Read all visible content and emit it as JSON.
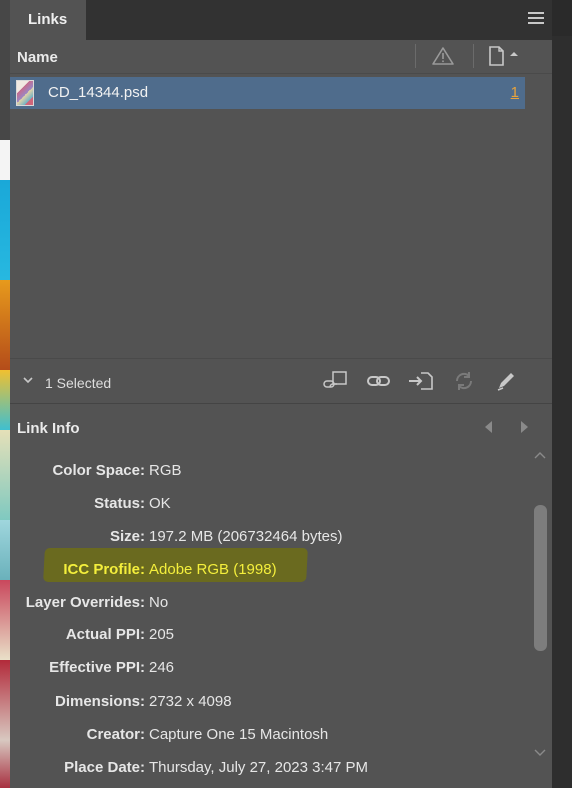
{
  "panel": {
    "tab_label": "Links"
  },
  "list": {
    "column_name": "Name",
    "items": [
      {
        "name": "CD_14344.psd",
        "page": "1"
      }
    ]
  },
  "toolbar": {
    "selection_text": "1 Selected",
    "icons": [
      "relink-from-cc-icon",
      "relink-icon",
      "go-to-link-icon",
      "update-link-icon",
      "edit-original-icon"
    ]
  },
  "link_info": {
    "title": "Link Info",
    "rows": [
      {
        "label": "Color Space:",
        "value": "RGB"
      },
      {
        "label": "Status:",
        "value": "OK"
      },
      {
        "label": "Size:",
        "value": "197.2 MB (206732464 bytes)"
      },
      {
        "label": "ICC Profile:",
        "value": "Adobe RGB (1998)"
      },
      {
        "label": "Layer Overrides:",
        "value": "No"
      },
      {
        "label": "Actual PPI:",
        "value": "205"
      },
      {
        "label": "Effective PPI:",
        "value": "246"
      },
      {
        "label": "Dimensions:",
        "value": "2732 x 4098"
      },
      {
        "label": "Creator:",
        "value": "Capture One 15 Macintosh"
      },
      {
        "label": "Place Date:",
        "value": "Thursday, July 27, 2023 3:47 PM"
      }
    ]
  },
  "colors": {
    "panel_bg": "#535353",
    "selected_row": "#4f6c8c",
    "page_link": "#e8a33b",
    "highlight_text": "#f4ef3c",
    "highlight_bg": "#6a6a1f"
  }
}
